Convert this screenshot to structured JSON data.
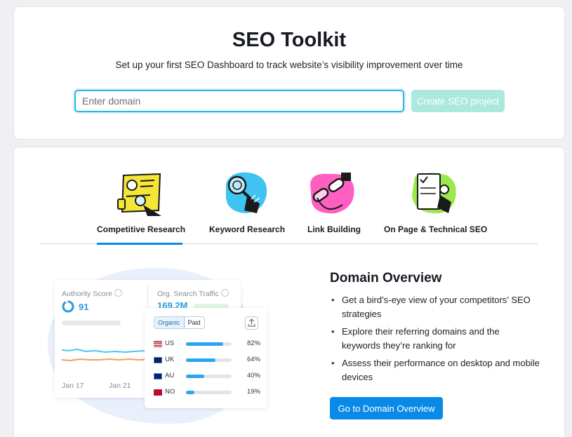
{
  "header": {
    "title": "SEO Toolkit",
    "subtitle": "Set up your first SEO Dashboard to track website’s visibility improvement over time"
  },
  "domain_form": {
    "placeholder": "Enter domain",
    "value": "",
    "button_label": "Create SEO project"
  },
  "tabs": [
    {
      "label": "Competitive Research",
      "active": true,
      "icon": "magnifier-card-icon"
    },
    {
      "label": "Keyword Research",
      "active": false,
      "icon": "magnifying-glass-icon"
    },
    {
      "label": "Link Building",
      "active": false,
      "icon": "chain-link-icon"
    },
    {
      "label": "On Page & Technical SEO",
      "active": false,
      "icon": "checklist-icon"
    }
  ],
  "preview": {
    "authority_label": "Authority Score",
    "authority_value": "91",
    "traffic_label": "Org. Search Traffic",
    "traffic_value": "169.2M",
    "dates": [
      "Jan 17",
      "Jan 21"
    ],
    "segments": [
      "Organic",
      "Paid"
    ],
    "countries": [
      {
        "code": "US",
        "pct_label": "82%",
        "share": 0.82
      },
      {
        "code": "UK",
        "pct_label": "64%",
        "share": 0.64
      },
      {
        "code": "AU",
        "pct_label": "40%",
        "share": 0.4
      },
      {
        "code": "NO",
        "pct_label": "19%",
        "share": 0.19
      }
    ]
  },
  "feature": {
    "title": "Domain Overview",
    "bullets": [
      "Get a bird’s-eye view of your competitors’ SEO strategies",
      "Explore their referring domains and the keywords they’re ranking for",
      "Assess their performance on desktop and mobile devices"
    ],
    "cta_label": "Go to Domain Overview"
  },
  "colors": {
    "accent": "#0a8ae8",
    "input_focus": "#2bb5ea",
    "disabled_button": "#abe8dd",
    "bar": "#2aa5f2"
  }
}
